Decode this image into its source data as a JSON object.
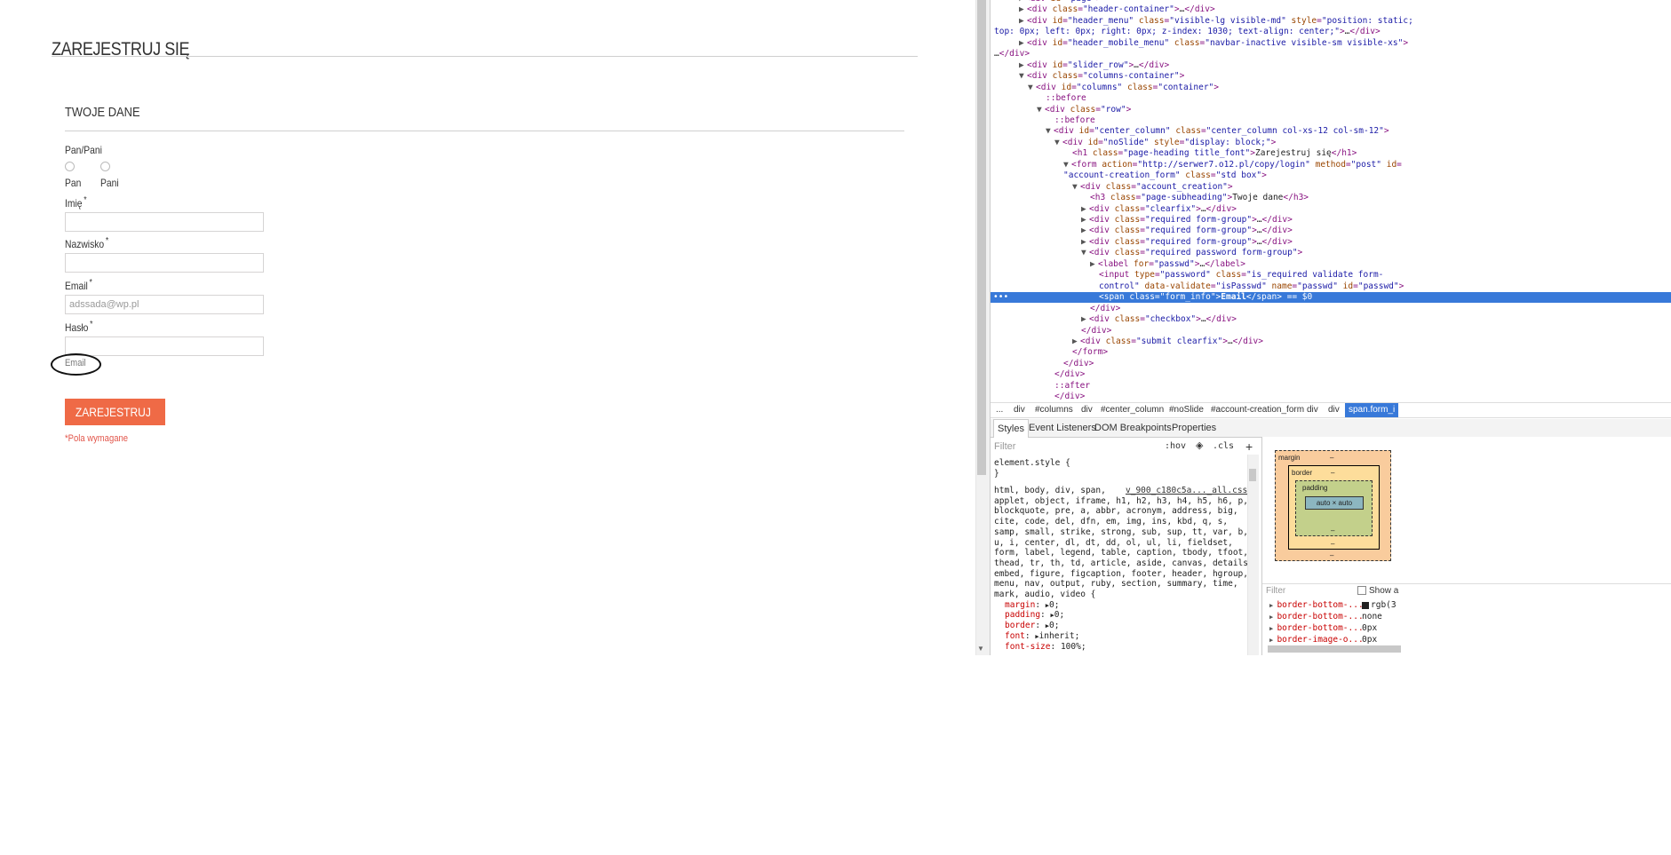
{
  "form": {
    "page_title": "ZAREJESTRUJ SIĘ",
    "subheading": "TWOJE DANE",
    "gender_label": "Pan/Pani",
    "gender_options": [
      "Pan",
      "Pani"
    ],
    "first_name_label": "Imię",
    "last_name_label": "Nazwisko",
    "email_label": "Email",
    "password_label": "Hasło",
    "required_star": "*",
    "email_value": "adssada@wp.pl",
    "email_info": "Email",
    "submit_label": "ZAREJESTRUJ",
    "required_note": "*Pola wymagane"
  },
  "devtools": {
    "crumbs": [
      "...",
      "div",
      "#columns",
      "div",
      "#center_column",
      "#noSlide",
      "#account-creation_form",
      "div",
      "div",
      "span.form_i"
    ],
    "tabs": [
      "Styles",
      "Event Listeners",
      "DOM Breakpoints",
      "Properties"
    ],
    "filter_placeholder": "Filter",
    "hov": ":hov",
    "cls": ".cls",
    "plus": "+",
    "element_style": "element.style {",
    "element_style_close": "}",
    "source_link": "v_900_c180c5a..._all.css:2",
    "selector_lines": [
      "html, body, div, span,",
      "applet, object, iframe, h1, h2, h3, h4, h5, h6, p,",
      "blockquote, pre, a, abbr, acronym, address, big,",
      "cite, code, del, dfn, em, img, ins, kbd, q, s,",
      "samp, small, strike, strong, sub, sup, tt, var, b,",
      "u, i, center, dl, dt, dd, ol, ul, li, fieldset,",
      "form, label, legend, table, caption, tbody, tfoot,",
      "thead, tr, th, td, article, aside, canvas, details,",
      "embed, figure, figcaption, footer, header, hgroup,",
      "menu, nav, output, ruby, section, summary, time,",
      "mark, audio, video {"
    ],
    "declarations": [
      {
        "prop": "margin",
        "val": "0;",
        "arrow": true
      },
      {
        "prop": "padding",
        "val": "0;",
        "arrow": true
      },
      {
        "prop": "border",
        "val": "0;",
        "arrow": true
      },
      {
        "prop": "font",
        "val": "inherit;",
        "arrow": true
      },
      {
        "prop": "font-size",
        "val": "100%;",
        "arrow": false
      }
    ],
    "box_model": {
      "margin": "margin",
      "border": "border",
      "padding": "padding",
      "content": "auto × auto",
      "dash": "–"
    },
    "computed_filter_placeholder": "Filter",
    "show_all": "Show a",
    "computed": [
      {
        "name": "border-bottom-...",
        "value": "rgb(3"
      },
      {
        "name": "border-bottom-...",
        "value": "none"
      },
      {
        "name": "border-bottom-...",
        "value": "0px"
      },
      {
        "name": "border-image-o...",
        "value": "0px"
      }
    ]
  }
}
